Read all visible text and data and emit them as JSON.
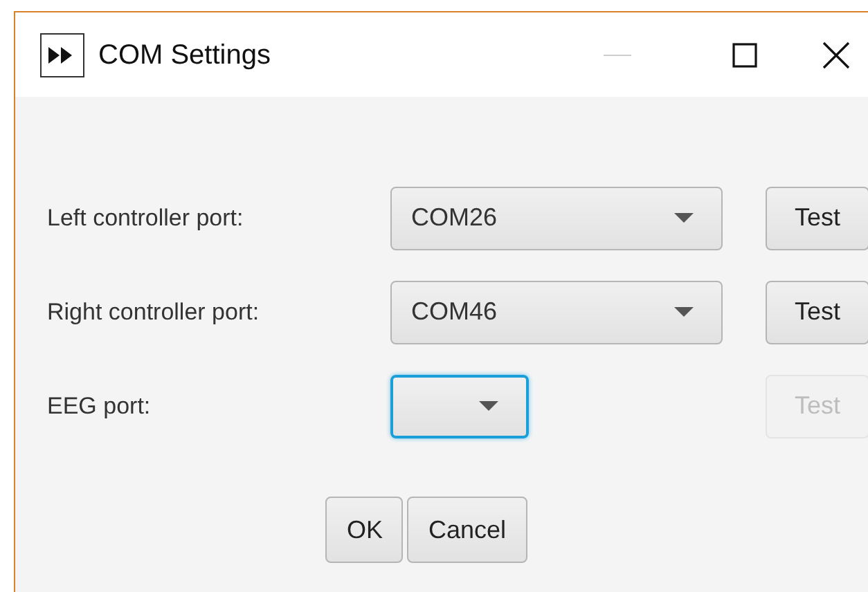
{
  "window": {
    "title": "COM Settings",
    "minimize_disabled": true
  },
  "ports": [
    {
      "label": "Left controller port:",
      "value": "COM26",
      "focused": false,
      "test": {
        "label": "Test",
        "disabled": false
      }
    },
    {
      "label": "Right controller port:",
      "value": "COM46",
      "focused": false,
      "test": {
        "label": "Test",
        "disabled": false
      }
    },
    {
      "label": "EEG port:",
      "focused": true,
      "test": {
        "label": "Test",
        "disabled": true
      }
    }
  ],
  "buttons": [
    "OK",
    "Cancel"
  ]
}
